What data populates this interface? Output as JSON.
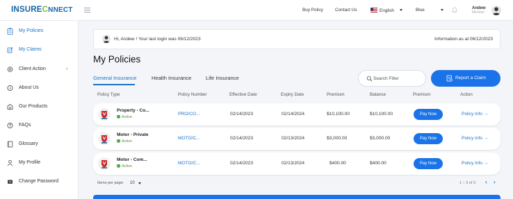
{
  "brand": {
    "logo_part1": "INSURE",
    "logo_part2": "C",
    "logo_part3": "NNECT"
  },
  "topbar": {
    "buy_policy": "Buy Policy",
    "contact_us": "Contact Us",
    "language": "English",
    "theme": "Blue",
    "user_name": "Andew",
    "user_role": "Member"
  },
  "sidebar": {
    "items": [
      {
        "label": "My Policies",
        "icon": "clipboard-icon"
      },
      {
        "label": "My Claims",
        "icon": "claims-icon"
      },
      {
        "label": "Client Action",
        "icon": "gear-icon",
        "has_submenu": true
      },
      {
        "label": "About Us",
        "icon": "info-icon"
      },
      {
        "label": "Our Products",
        "icon": "products-icon"
      },
      {
        "label": "FAQs",
        "icon": "question-icon"
      },
      {
        "label": "Glossary",
        "icon": "book-icon"
      },
      {
        "label": "My Profile",
        "icon": "user-icon"
      },
      {
        "label": "Change Password",
        "icon": "password-icon"
      }
    ]
  },
  "welcome": {
    "message": "Hi, Andew ! Your last login was 06/12/2023",
    "info_date": "Information as at 06/12/2023"
  },
  "page": {
    "title": "My Policies"
  },
  "tabs": [
    {
      "label": "General Insurance"
    },
    {
      "label": "Health Insurance"
    },
    {
      "label": "Life Insurance"
    }
  ],
  "search": {
    "placeholder": "Search Filter"
  },
  "report_button": {
    "label": "Report a Claim"
  },
  "table": {
    "headers": [
      "Policy Type",
      "Policy Number",
      "Effective Date",
      "Expiry Date",
      "Premium",
      "Balance",
      "Premium",
      "Action"
    ],
    "rows": [
      {
        "type": "Property - Co...",
        "status": "Active",
        "number": "PRO/CO...",
        "effective": "02/14/2023",
        "expiry": "02/14/2024",
        "premium": "$10,100.00",
        "balance": "$10,100.00",
        "pay": "Pay Now",
        "action": "Policy Info →"
      },
      {
        "type": "Motor - Private",
        "status": "Active",
        "number": "MOTO/C...",
        "effective": "02/14/2023",
        "expiry": "02/13/2024",
        "premium": "$3,000.00",
        "balance": "$3,000.00",
        "pay": "Pay Now",
        "action": "Policy Info →"
      },
      {
        "type": "Motor - Com...",
        "status": "Active",
        "number": "MOTO/C...",
        "effective": "02/14/2023",
        "expiry": "02/13/2024",
        "premium": "$400.00",
        "balance": "$400.00",
        "pay": "Pay Now",
        "action": "Policy Info →"
      }
    ]
  },
  "pagination": {
    "items_per_page_label": "Items per page:",
    "items_per_page": "10",
    "range": "1 – 3 of 3",
    "prev": "‹",
    "next": "›"
  },
  "colors": {
    "accent": "#1a73e8",
    "link": "#1a73c7",
    "active_status": "#4caf50"
  }
}
